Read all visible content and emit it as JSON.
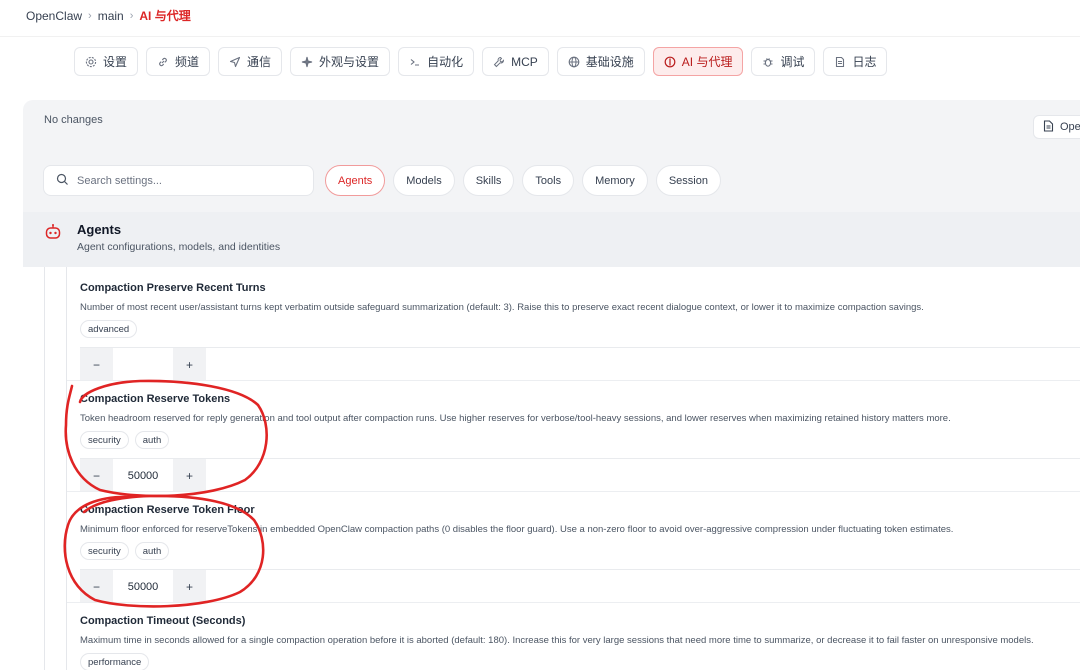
{
  "breadcrumb": {
    "root": "OpenClaw",
    "branch": "main",
    "current": "AI 与代理"
  },
  "nav_tabs": [
    {
      "label": "设置",
      "icon": "gear-icon",
      "active": false
    },
    {
      "label": "频道",
      "icon": "link-icon",
      "active": false
    },
    {
      "label": "通信",
      "icon": "send-icon",
      "active": false
    },
    {
      "label": "外观与设置",
      "icon": "sparkle-icon",
      "active": false
    },
    {
      "label": "自动化",
      "icon": "terminal-icon",
      "active": false
    },
    {
      "label": "MCP",
      "icon": "wrench-icon",
      "active": false
    },
    {
      "label": "基础设施",
      "icon": "globe-icon",
      "active": false
    },
    {
      "label": "AI 与代理",
      "icon": "brain-icon",
      "active": true
    },
    {
      "label": "调试",
      "icon": "bug-icon",
      "active": false
    },
    {
      "label": "日志",
      "icon": "document-icon",
      "active": false
    }
  ],
  "status": {
    "no_changes": "No changes",
    "open_label": "Ope"
  },
  "search": {
    "placeholder": "Search settings..."
  },
  "filter_chips": [
    {
      "label": "Agents",
      "active": true
    },
    {
      "label": "Models",
      "active": false
    },
    {
      "label": "Skills",
      "active": false
    },
    {
      "label": "Tools",
      "active": false
    },
    {
      "label": "Memory",
      "active": false
    },
    {
      "label": "Session",
      "active": false
    }
  ],
  "section": {
    "title": "Agents",
    "subtitle": "Agent configurations, models, and identities"
  },
  "fields": [
    {
      "title": "Compaction Preserve Recent Turns",
      "description": "Number of most recent user/assistant turns kept verbatim outside safeguard summarization (default: 3). Raise this to preserve exact recent dialogue context, or lower it to maximize compaction savings.",
      "tags": [
        "advanced"
      ],
      "value": ""
    },
    {
      "title": "Compaction Reserve Tokens",
      "description": "Token headroom reserved for reply generation and tool output after compaction runs. Use higher reserves for verbose/tool-heavy sessions, and lower reserves when maximizing retained history matters more.",
      "tags": [
        "security",
        "auth"
      ],
      "value": "50000"
    },
    {
      "title": "Compaction Reserve Token Floor",
      "description": "Minimum floor enforced for reserveTokens in embedded OpenClaw compaction paths (0 disables the floor guard). Use a non-zero floor to avoid over-aggressive compression under fluctuating token estimates.",
      "tags": [
        "security",
        "auth"
      ],
      "value": "50000"
    },
    {
      "title": "Compaction Timeout (Seconds)",
      "description": "Maximum time in seconds allowed for a single compaction operation before it is aborted (default: 180). Increase this for very large sessions that need more time to summarize, or decrease it to fail faster on unresponsive models.",
      "tags": [
        "performance"
      ],
      "value": ""
    }
  ],
  "stepper": {
    "minus": "−",
    "plus": "+"
  },
  "colors": {
    "accent": "#dc2626",
    "annotation": "#e02424"
  }
}
